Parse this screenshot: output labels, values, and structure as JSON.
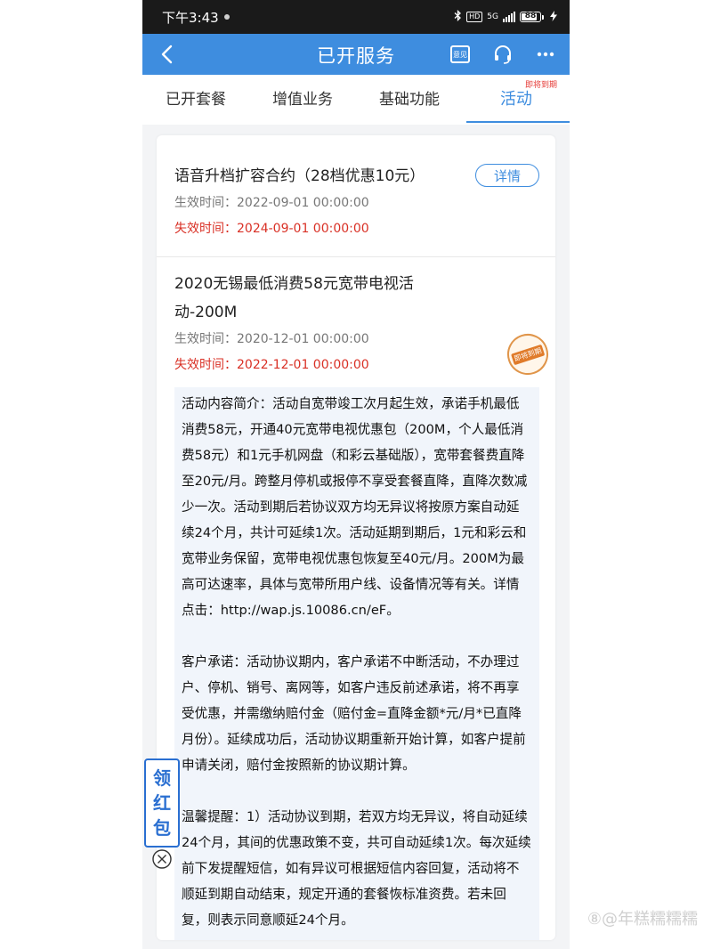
{
  "status_bar": {
    "time": "下午3:43",
    "network": "5G",
    "hd": "HD",
    "battery": "88",
    "battery_level": 0.88,
    "icons": [
      "bluetooth-icon",
      "hd-icon",
      "signal-icon",
      "battery-icon",
      "charging-icon"
    ]
  },
  "nav": {
    "title": "已开服务",
    "feedback_label": "意见",
    "icons": [
      "back-icon",
      "feedback-icon",
      "headset-icon",
      "more-icon"
    ]
  },
  "tabs": [
    {
      "label": "已开套餐",
      "active": false
    },
    {
      "label": "增值业务",
      "active": false
    },
    {
      "label": "基础功能",
      "active": false
    },
    {
      "label": "活动",
      "active": true,
      "badge": "即将到期"
    }
  ],
  "items": [
    {
      "title": "语音升档扩容合约（28档优惠10元）",
      "start": "生效时间：2022-09-01 00:00:00",
      "end": "失效时间：2024-09-01 00:00:00",
      "button": "详情"
    },
    {
      "title": "2020无锡最低消费58元宽带电视活动-200M",
      "start": "生效时间：2020-12-01 00:00:00",
      "end": "失效时间：2022-12-01 00:00:00",
      "stamp": "即将到期",
      "description": [
        "活动内容简介：活动自宽带竣工次月起生效，承诺手机最低消费58元，开通40元宽带电视优惠包（200M，个人最低消费58元）和1元手机网盘（和彩云基础版），宽带套餐费直降至20元/月。跨整月停机或报停不享受套餐直降，直降次数减少一次。活动到期后若协议双方均无异议将按原方案自动延续24个月，共计可延续1次。活动延期到期后，1元和彩云和宽带业务保留，宽带电视优惠包恢复至40元/月。200M为最高可达速率，具体与宽带所用户线、设备情况等有关。详情点击：http://wap.js.10086.cn/eF。",
        "客户承诺：活动协议期内，客户承诺不中断活动，不办理过户、停机、销号、离网等，如客户违反前述承诺，将不再享受优惠，并需缴纳赔付金（赔付金=直降金额*元/月*已直降月份）。延续成功后，活动协议期重新开始计算，如客户提前申请关闭，赔付金按照新的协议期计算。",
        "温馨提醒：1）活动协议到期，若双方均无异议，将自动延续24个月，其间的优惠政策不变，共可自动延续1次。每次延续前下发提醒短信，如有异议可根据短信内容回复，活动将不顺延到期自动结束，规定开通的套餐恢标准资费。若未回复，则表示同意顺延24个月。"
      ]
    }
  ],
  "float_button": {
    "chars": [
      "领",
      "红",
      "包"
    ]
  },
  "watermark": "⑧@年糕糯糯糯"
}
